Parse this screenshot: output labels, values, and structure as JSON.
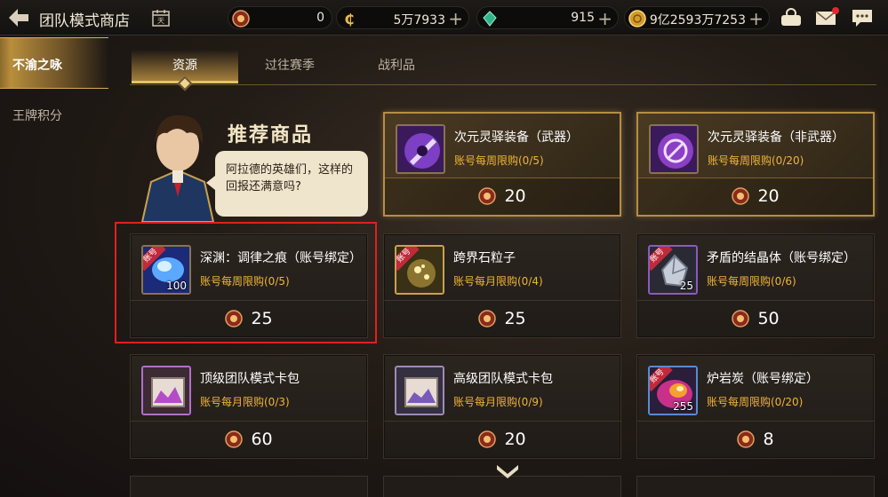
{
  "header": {
    "title": "团队模式商店",
    "currencies": [
      {
        "icon": "red-coin-icon",
        "value": "0",
        "has_plus": false
      },
      {
        "icon": "gold-c-coin-icon",
        "value": "5万7933",
        "has_plus": true
      },
      {
        "icon": "green-crystal-icon",
        "value": "915",
        "has_plus": true
      },
      {
        "icon": "gold-coin-icon",
        "value": "9亿2593万7253",
        "has_plus": true
      }
    ],
    "plus": "+"
  },
  "sidebar": {
    "items": [
      {
        "label": "不渝之咏",
        "active": true
      },
      {
        "label": "王牌积分",
        "active": false
      }
    ]
  },
  "tabs": [
    {
      "label": "资源",
      "active": true
    },
    {
      "label": "过往赛季",
      "active": false
    },
    {
      "label": "战利品",
      "active": false
    }
  ],
  "featured": {
    "title": "推荐商品",
    "dialogue": "阿拉德的英雄们，这样的回报还满意吗?"
  },
  "items": [
    {
      "name": "次元灵驿装备（武器）",
      "limit": "账号每周限购(0/5)",
      "price": "20",
      "qty": "",
      "tag": "",
      "featured": true,
      "icon": "purple-weapon-icon"
    },
    {
      "name": "次元灵驿装备（非武器）",
      "limit": "账号每周限购(0/20)",
      "price": "20",
      "qty": "",
      "tag": "",
      "featured": true,
      "icon": "purple-armor-icon"
    },
    {
      "name": "深渊：调律之痕（账号绑定）",
      "limit": "账号每周限购(0/5)",
      "price": "25",
      "qty": "100",
      "tag": "账号",
      "featured": false,
      "icon": "blue-orb-icon"
    },
    {
      "name": "跨界石粒子",
      "limit": "账号每月限购(0/4)",
      "price": "25",
      "qty": "",
      "tag": "账号",
      "featured": false,
      "icon": "gold-particle-icon"
    },
    {
      "name": "矛盾的结晶体（账号绑定）",
      "limit": "账号每周限购(0/6)",
      "price": "50",
      "qty": "25",
      "tag": "账号",
      "featured": false,
      "icon": "crystal-icon"
    },
    {
      "name": "顶级团队模式卡包",
      "limit": "账号每月限购(0/3)",
      "price": "60",
      "qty": "",
      "tag": "",
      "featured": false,
      "icon": "card-pack-icon"
    },
    {
      "name": "高级团队模式卡包",
      "limit": "账号每月限购(0/9)",
      "price": "20",
      "qty": "",
      "tag": "",
      "featured": false,
      "icon": "card-pack-icon"
    },
    {
      "name": "炉岩炭（账号绑定）",
      "limit": "账号每周限购(0/20)",
      "price": "8",
      "qty": "255",
      "tag": "账号",
      "featured": false,
      "icon": "lava-coal-icon"
    }
  ]
}
